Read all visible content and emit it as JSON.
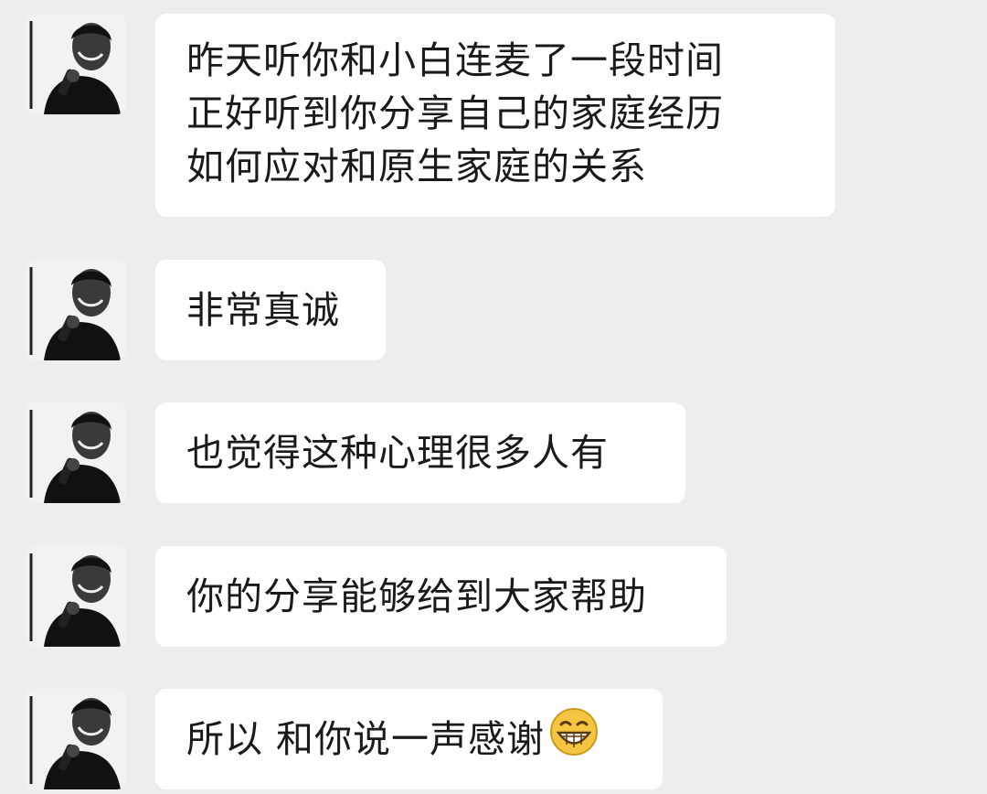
{
  "chat": {
    "messages": [
      {
        "sender_avatar": "man-with-microphone-avatar",
        "lines": [
          "昨天听你和小白连麦了一段时间",
          "正好听到你分享自己的家庭经历",
          "如何应对和原生家庭的关系"
        ]
      },
      {
        "sender_avatar": "man-with-microphone-avatar",
        "lines": [
          "非常真诚"
        ]
      },
      {
        "sender_avatar": "man-with-microphone-avatar",
        "lines": [
          "也觉得这种心理很多人有"
        ]
      },
      {
        "sender_avatar": "man-with-microphone-avatar",
        "lines": [
          "你的分享能够给到大家帮助"
        ]
      },
      {
        "sender_avatar": "man-with-microphone-avatar",
        "lines": [
          "所以 和你说一声感谢"
        ],
        "emoji": "grinning-face-emoji"
      }
    ]
  },
  "colors": {
    "background": "#ededed",
    "bubble": "#ffffff",
    "text": "#1a1a1a",
    "emoji_face": "#f5c542"
  }
}
